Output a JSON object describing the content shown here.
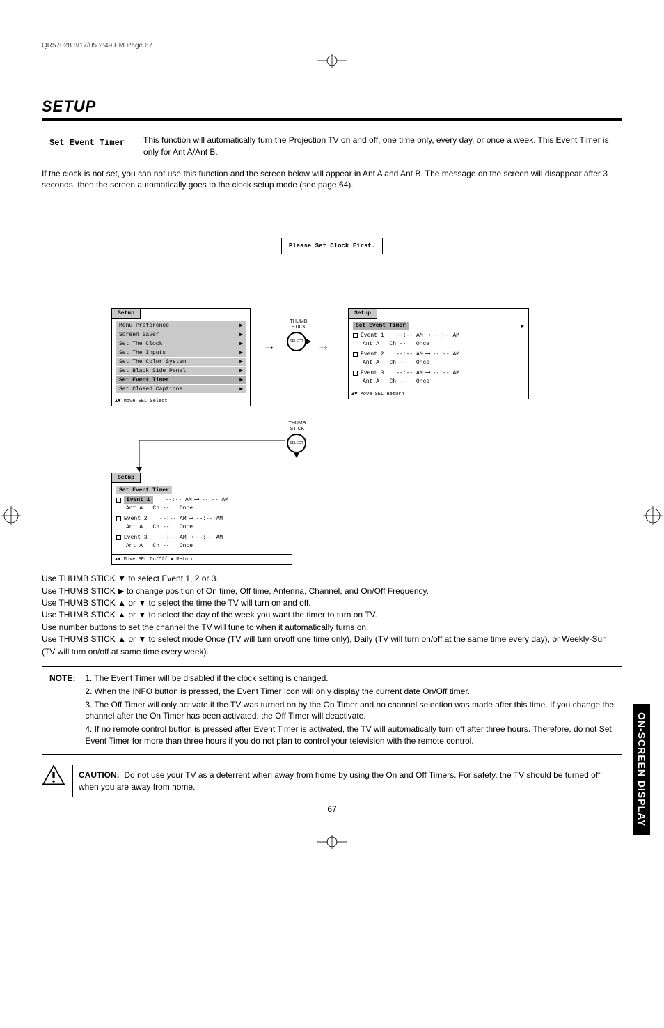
{
  "print_header": "QR57028  8/17/05  2:49 PM  Page 67",
  "section_title": "SETUP",
  "label_box": "Set Event Timer",
  "intro_text": "This function will automatically turn the Projection TV on and off, one time only, every day, or once a week.  This Event Timer is only for Ant A/Ant B.",
  "body_text": "If the clock is not set, you can not use this function and the screen below will appear in Ant A and Ant B.  The message on the screen will disappear after 3 seconds, then the screen automatically goes to the clock setup mode (see page 64).",
  "clock_msg": "Please Set Clock First.",
  "thumb_label": "THUMB\nSTICK",
  "setup_menu": {
    "title": "Setup",
    "items": [
      "Menu Preference",
      "Screen Saver",
      "Set The Clock",
      "Set The Inputs",
      "Set The Color System",
      "Set Black Side Panel",
      "Set Event Timer",
      "Set Closed Captions"
    ],
    "selected": "Set Event Timer",
    "footer": "▲▼ Move  SEL Select"
  },
  "event_panel_title": "Set Event Timer",
  "event_panel_setup": "Setup",
  "events": [
    {
      "name": "Event 1",
      "on": "--:-- AM",
      "off": "--:-- AM",
      "ant": "Ant A",
      "ch": "Ch --",
      "freq": "Once"
    },
    {
      "name": "Event 2",
      "on": "--:-- AM",
      "off": "--:-- AM",
      "ant": "Ant A",
      "ch": "Ch --",
      "freq": "Once"
    },
    {
      "name": "Event 3",
      "on": "--:-- AM",
      "off": "--:-- AM",
      "ant": "Ant A",
      "ch": "Ch --",
      "freq": "Once"
    }
  ],
  "event_footer_right": "▲▼ Move  SEL Return",
  "event_footer_bottom": "▲▼ Move  SEL On/Off  ◀ Return",
  "instructions": {
    "l1": "Use THUMB STICK ▼ to select Event 1, 2 or 3.",
    "l2": "Use THUMB STICK ▶ to change position of On time, Off time, Antenna, Channel, and On/Off Frequency.",
    "l3": "Use THUMB STICK ▲ or ▼ to select the time the TV will turn on and off.",
    "l4": "Use THUMB STICK ▲ or ▼ to select the day of the week you want the timer to turn on TV.",
    "l5": "Use number buttons to set the channel the TV will tune to when it automatically turns on.",
    "l6": "Use THUMB STICK ▲ or ▼ to select mode Once (TV will turn on/off one time only), Daily (TV will turn on/off at the same time every day), or Weekly-Sun (TV will turn on/off at same time every week)."
  },
  "note": {
    "label": "NOTE:",
    "items": [
      "1. The Event Timer will be disabled if the clock setting is changed.",
      "2. When the INFO button is pressed, the Event Timer Icon will only display the current date On/Off timer.",
      "3. The Off Timer will only activate if the TV was turned on by the On Timer and no channel selection was made after this time.  If you change the channel after the On Timer has been activated, the Off Timer will deactivate.",
      "4. If no remote control button is pressed after Event Timer is activated, the TV will automatically turn off after three hours. Therefore, do not Set Event Timer for more than three hours if you do not plan to control your television with the remote control."
    ]
  },
  "caution": {
    "label": "CAUTION:",
    "text": "Do not use your TV as a deterrent when away from home by using the On and Off Timers.  For safety, the TV should be turned off when you are away from home."
  },
  "side_tab": "ON-SCREEN DISPLAY",
  "page_num": "67"
}
